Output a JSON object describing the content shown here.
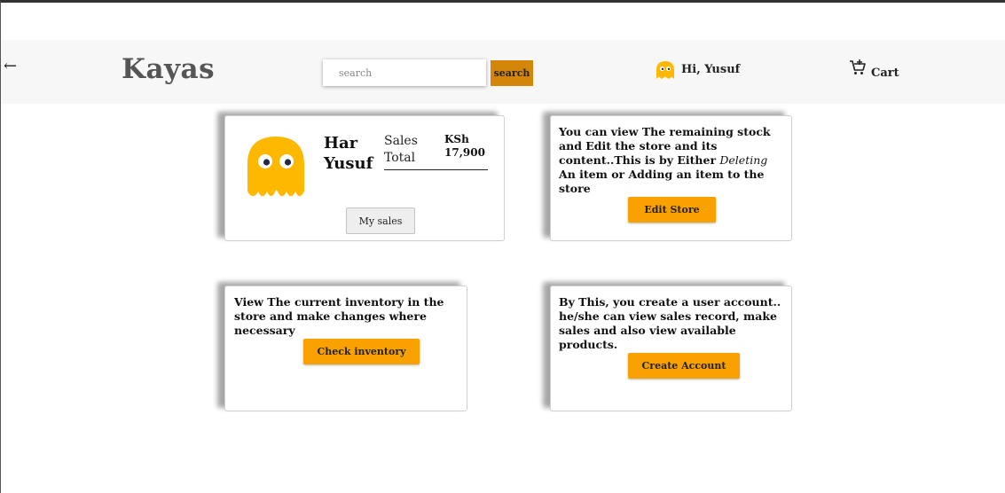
{
  "header": {
    "back_icon": "arrow-left-icon",
    "brand": "Kayas",
    "search_placeholder": "search",
    "search_button": "search",
    "user_greeting": "Hi, Yusuf",
    "cart_label": "Cart",
    "accent_color": "#d4860b"
  },
  "profile_card": {
    "name_line1": "Har",
    "name_line2": "Yusuf",
    "sales_label_line1": "Sales",
    "sales_label_line2": "Total",
    "currency": "KSh",
    "sales_total": "17,900",
    "button": "My sales"
  },
  "store_card": {
    "text_part1": "You can view The remaining stock and Edit the store and its content..This is by Either ",
    "text_em": "Deleting",
    "text_part2": " An item or Adding an item to the store",
    "button": "Edit Store"
  },
  "inventory_card": {
    "text": "View The current inventory in the store and make changes where necessary",
    "button": "Check inventory"
  },
  "account_card": {
    "text": "By This, you create a user account.. he/she can view sales record, make sales and also view available products.",
    "button": "Create Account"
  },
  "colors": {
    "button_orange": "#f9a100",
    "avatar_yellow": "#ffb800"
  }
}
